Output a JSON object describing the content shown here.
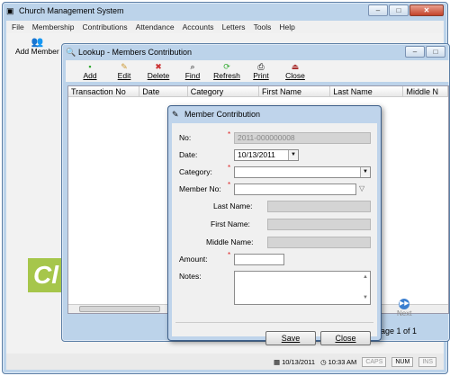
{
  "main": {
    "title": "Church Management System",
    "menu": [
      "File",
      "Membership",
      "Contributions",
      "Attendance",
      "Accounts",
      "Letters",
      "Tools",
      "Help"
    ],
    "add_member_label": "Add Member",
    "logo_text": "Cl",
    "status": {
      "date": "10/13/2011",
      "time": "10:33 AM",
      "keys": [
        "CAPS",
        "NUM",
        "INS"
      ]
    }
  },
  "lookup": {
    "title": "Lookup - Members Contribution",
    "toolbar": [
      {
        "label": "Add",
        "icon": "add-icon"
      },
      {
        "label": "Edit",
        "icon": "edit-icon"
      },
      {
        "label": "Delete",
        "icon": "delete-icon"
      },
      {
        "label": "Find",
        "icon": "find-icon"
      },
      {
        "label": "Refresh",
        "icon": "refresh-icon"
      },
      {
        "label": "Print",
        "icon": "print-icon"
      },
      {
        "label": "Close",
        "icon": "close-icon"
      }
    ],
    "columns": [
      "Transaction No",
      "Date",
      "Category",
      "First Name",
      "Last Name",
      "Middle N"
    ],
    "next_label": "Next",
    "page_info": "age 1 of 1"
  },
  "dialog": {
    "title": "Member Contribution",
    "labels": {
      "no": "No:",
      "date": "Date:",
      "category": "Category:",
      "member_no": "Member No:",
      "last_name": "Last Name:",
      "first_name": "First Name:",
      "middle_name": "Middle Name:",
      "amount": "Amount:",
      "notes": "Notes:"
    },
    "values": {
      "no": "2011-000000008",
      "date": "10/13/2011",
      "category": "",
      "member_no": "",
      "last_name": "",
      "first_name": "",
      "middle_name": "",
      "amount": "",
      "notes": ""
    },
    "save_label": "Save",
    "close_label": "Close"
  }
}
